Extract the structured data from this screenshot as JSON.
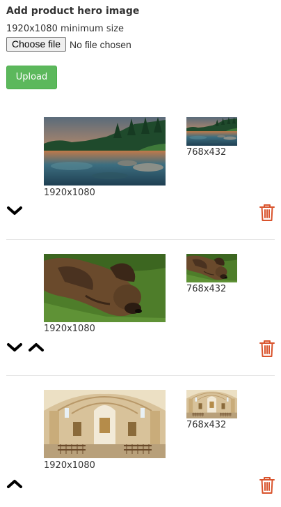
{
  "form": {
    "heading": "Add product hero image",
    "size_hint": "1920x1080 minimum size",
    "file_input": {
      "button_label": "Choose file",
      "status": "No file chosen"
    },
    "upload_label": "Upload"
  },
  "images": [
    {
      "subject": "lake landscape at sunset",
      "large_size": "1920x1080",
      "small_size": "768x432",
      "controls": [
        "move-down"
      ]
    },
    {
      "subject": "brindle dog lying on grass",
      "large_size": "1920x1080",
      "small_size": "768x432",
      "controls": [
        "move-down",
        "move-up"
      ]
    },
    {
      "subject": "baroque church interior",
      "large_size": "1920x1080",
      "small_size": "768x432",
      "controls": [
        "move-up"
      ]
    }
  ],
  "colors": {
    "upload_button": "#5cb85c",
    "delete_icon": "#d9532c",
    "arrow_icon": "#000000"
  },
  "icons": {
    "move_down": "chevron-down-icon",
    "move_up": "chevron-up-icon",
    "delete": "trash-icon"
  }
}
